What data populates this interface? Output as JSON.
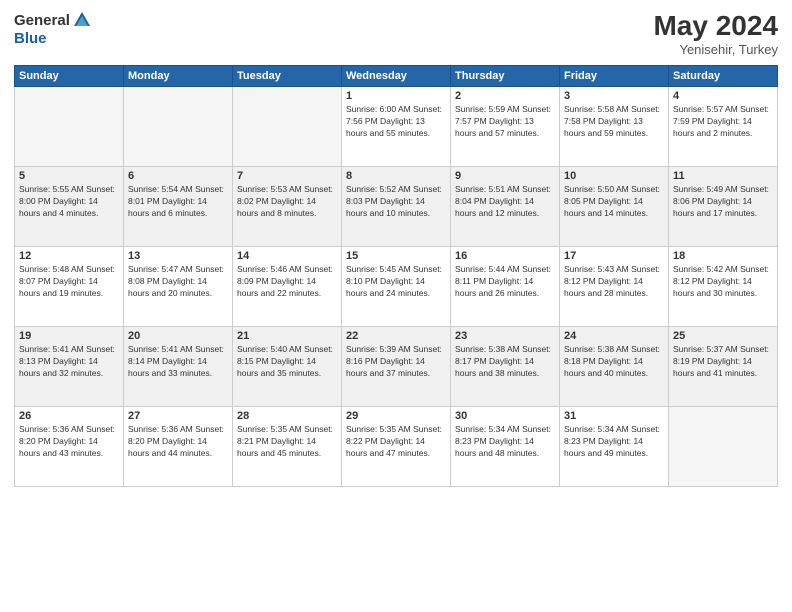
{
  "logo": {
    "general": "General",
    "blue": "Blue"
  },
  "title": {
    "month": "May 2024",
    "location": "Yenisehir, Turkey"
  },
  "weekdays": [
    "Sunday",
    "Monday",
    "Tuesday",
    "Wednesday",
    "Thursday",
    "Friday",
    "Saturday"
  ],
  "weeks": [
    [
      {
        "day": "",
        "detail": ""
      },
      {
        "day": "",
        "detail": ""
      },
      {
        "day": "",
        "detail": ""
      },
      {
        "day": "1",
        "detail": "Sunrise: 6:00 AM\nSunset: 7:56 PM\nDaylight: 13 hours\nand 55 minutes."
      },
      {
        "day": "2",
        "detail": "Sunrise: 5:59 AM\nSunset: 7:57 PM\nDaylight: 13 hours\nand 57 minutes."
      },
      {
        "day": "3",
        "detail": "Sunrise: 5:58 AM\nSunset: 7:58 PM\nDaylight: 13 hours\nand 59 minutes."
      },
      {
        "day": "4",
        "detail": "Sunrise: 5:57 AM\nSunset: 7:59 PM\nDaylight: 14 hours\nand 2 minutes."
      }
    ],
    [
      {
        "day": "5",
        "detail": "Sunrise: 5:55 AM\nSunset: 8:00 PM\nDaylight: 14 hours\nand 4 minutes."
      },
      {
        "day": "6",
        "detail": "Sunrise: 5:54 AM\nSunset: 8:01 PM\nDaylight: 14 hours\nand 6 minutes."
      },
      {
        "day": "7",
        "detail": "Sunrise: 5:53 AM\nSunset: 8:02 PM\nDaylight: 14 hours\nand 8 minutes."
      },
      {
        "day": "8",
        "detail": "Sunrise: 5:52 AM\nSunset: 8:03 PM\nDaylight: 14 hours\nand 10 minutes."
      },
      {
        "day": "9",
        "detail": "Sunrise: 5:51 AM\nSunset: 8:04 PM\nDaylight: 14 hours\nand 12 minutes."
      },
      {
        "day": "10",
        "detail": "Sunrise: 5:50 AM\nSunset: 8:05 PM\nDaylight: 14 hours\nand 14 minutes."
      },
      {
        "day": "11",
        "detail": "Sunrise: 5:49 AM\nSunset: 8:06 PM\nDaylight: 14 hours\nand 17 minutes."
      }
    ],
    [
      {
        "day": "12",
        "detail": "Sunrise: 5:48 AM\nSunset: 8:07 PM\nDaylight: 14 hours\nand 19 minutes."
      },
      {
        "day": "13",
        "detail": "Sunrise: 5:47 AM\nSunset: 8:08 PM\nDaylight: 14 hours\nand 20 minutes."
      },
      {
        "day": "14",
        "detail": "Sunrise: 5:46 AM\nSunset: 8:09 PM\nDaylight: 14 hours\nand 22 minutes."
      },
      {
        "day": "15",
        "detail": "Sunrise: 5:45 AM\nSunset: 8:10 PM\nDaylight: 14 hours\nand 24 minutes."
      },
      {
        "day": "16",
        "detail": "Sunrise: 5:44 AM\nSunset: 8:11 PM\nDaylight: 14 hours\nand 26 minutes."
      },
      {
        "day": "17",
        "detail": "Sunrise: 5:43 AM\nSunset: 8:12 PM\nDaylight: 14 hours\nand 28 minutes."
      },
      {
        "day": "18",
        "detail": "Sunrise: 5:42 AM\nSunset: 8:12 PM\nDaylight: 14 hours\nand 30 minutes."
      }
    ],
    [
      {
        "day": "19",
        "detail": "Sunrise: 5:41 AM\nSunset: 8:13 PM\nDaylight: 14 hours\nand 32 minutes."
      },
      {
        "day": "20",
        "detail": "Sunrise: 5:41 AM\nSunset: 8:14 PM\nDaylight: 14 hours\nand 33 minutes."
      },
      {
        "day": "21",
        "detail": "Sunrise: 5:40 AM\nSunset: 8:15 PM\nDaylight: 14 hours\nand 35 minutes."
      },
      {
        "day": "22",
        "detail": "Sunrise: 5:39 AM\nSunset: 8:16 PM\nDaylight: 14 hours\nand 37 minutes."
      },
      {
        "day": "23",
        "detail": "Sunrise: 5:38 AM\nSunset: 8:17 PM\nDaylight: 14 hours\nand 38 minutes."
      },
      {
        "day": "24",
        "detail": "Sunrise: 5:38 AM\nSunset: 8:18 PM\nDaylight: 14 hours\nand 40 minutes."
      },
      {
        "day": "25",
        "detail": "Sunrise: 5:37 AM\nSunset: 8:19 PM\nDaylight: 14 hours\nand 41 minutes."
      }
    ],
    [
      {
        "day": "26",
        "detail": "Sunrise: 5:36 AM\nSunset: 8:20 PM\nDaylight: 14 hours\nand 43 minutes."
      },
      {
        "day": "27",
        "detail": "Sunrise: 5:36 AM\nSunset: 8:20 PM\nDaylight: 14 hours\nand 44 minutes."
      },
      {
        "day": "28",
        "detail": "Sunrise: 5:35 AM\nSunset: 8:21 PM\nDaylight: 14 hours\nand 45 minutes."
      },
      {
        "day": "29",
        "detail": "Sunrise: 5:35 AM\nSunset: 8:22 PM\nDaylight: 14 hours\nand 47 minutes."
      },
      {
        "day": "30",
        "detail": "Sunrise: 5:34 AM\nSunset: 8:23 PM\nDaylight: 14 hours\nand 48 minutes."
      },
      {
        "day": "31",
        "detail": "Sunrise: 5:34 AM\nSunset: 8:23 PM\nDaylight: 14 hours\nand 49 minutes."
      },
      {
        "day": "",
        "detail": ""
      }
    ]
  ]
}
